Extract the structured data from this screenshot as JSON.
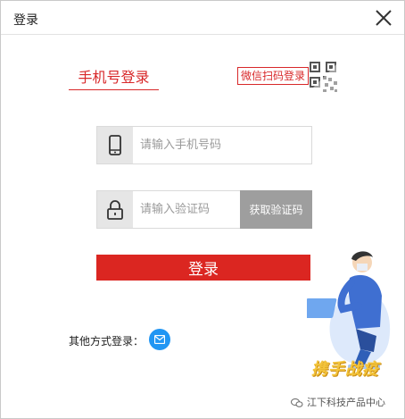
{
  "window": {
    "title": "登录"
  },
  "tabs": {
    "phone_login": "手机号登录",
    "wechat_login": "微信扫码登录"
  },
  "phone_input": {
    "placeholder": "请输入手机号码",
    "value": ""
  },
  "code_input": {
    "placeholder": "请输入验证码",
    "value": ""
  },
  "buttons": {
    "get_code": "获取验证码",
    "login": "登录"
  },
  "other_login": {
    "label": "其他方式登录："
  },
  "promo": {
    "text": "携手战疫"
  },
  "watermark": {
    "text": "江下科技产品中心"
  },
  "colors": {
    "accent": "#db2621",
    "mail": "#2196f3",
    "get_code_bg": "#9e9e9e"
  }
}
